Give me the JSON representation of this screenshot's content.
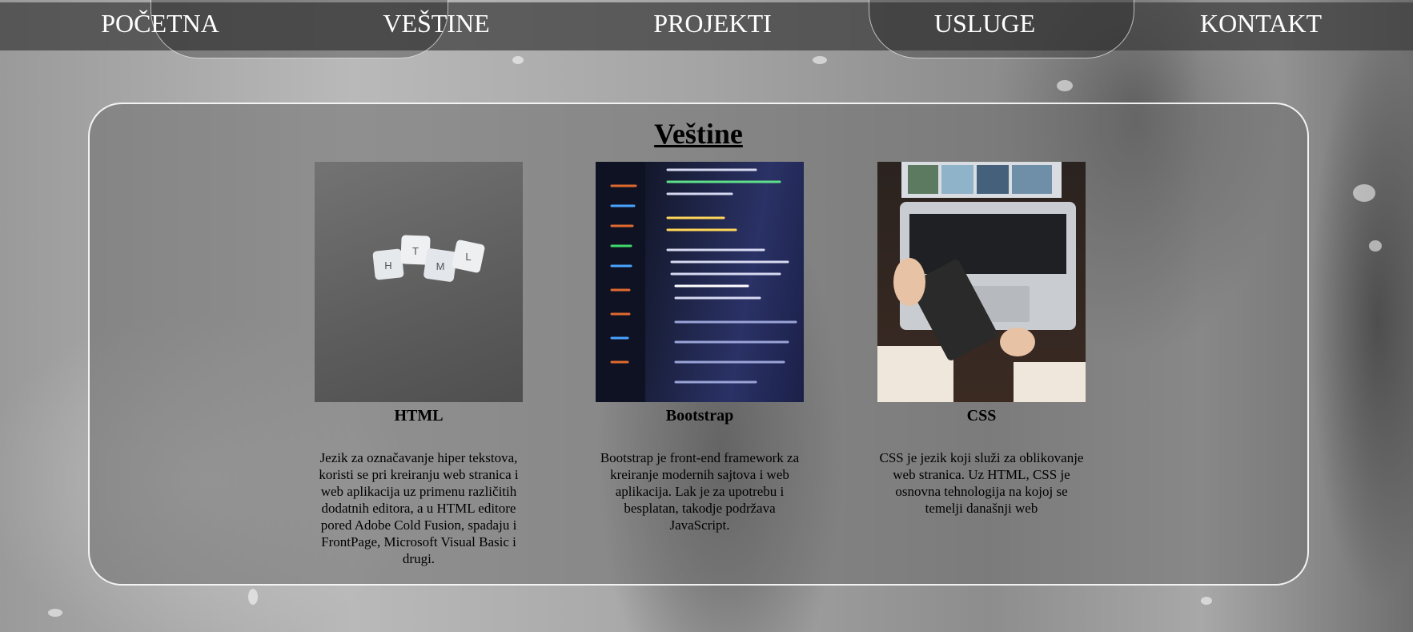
{
  "nav": {
    "items": [
      {
        "label": "POČETNA"
      },
      {
        "label": "VEŠTINE"
      },
      {
        "label": "PROJEKTI"
      },
      {
        "label": "USLUGE"
      },
      {
        "label": "KONTAKT"
      }
    ]
  },
  "section": {
    "title": "Veštine",
    "cards": [
      {
        "title": "HTML",
        "description": "Jezik za označavanje hiper tekstova, koristi se pri kreiranju web stranica i web aplikacija uz primenu različitih dodatnih editora, a u HTML editore pored Adobe Cold Fusion, spadaju i FrontPage, Microsoft Visual Basic i drugi.",
        "tiles": [
          "H",
          "T",
          "M",
          "L"
        ]
      },
      {
        "title": "Bootstrap",
        "description": "Bootstrap je front-end framework za kreiranje modernih sajtova i web aplikacija. Lak je za upotrebu i besplatan, takodje podržava JavaScript."
      },
      {
        "title": "CSS",
        "description": "CSS je jezik koji služi za oblikovanje web stranica. Uz HTML, CSS je osnovna tehnologija na kojoj se temelji današnji web"
      }
    ]
  },
  "colors": {
    "panel_border": "#ffffff",
    "nav_text": "#ffffff",
    "text": "#000000"
  }
}
